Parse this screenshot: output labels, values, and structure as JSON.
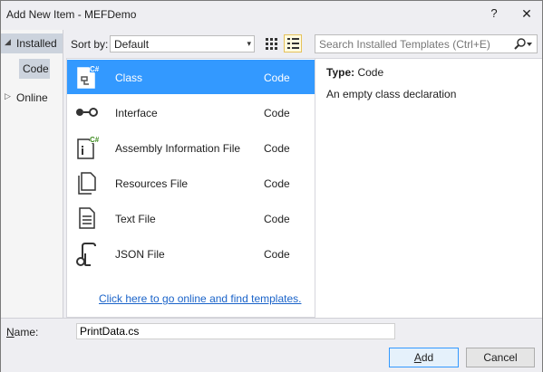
{
  "window": {
    "title": "Add New Item - MEFDemo",
    "help_glyph": "?",
    "close_glyph": "✕"
  },
  "tree": {
    "installed": {
      "arrow": "◢",
      "label": "Installed"
    },
    "code": "Code",
    "online": {
      "arrow": "▷",
      "label": "Online"
    }
  },
  "toolbar": {
    "sort_label": "Sort by:",
    "sort_value": "Default",
    "sort_caret": "▾",
    "search_placeholder": "Search Installed Templates (Ctrl+E)"
  },
  "items": [
    {
      "name": "Class",
      "type": "Code",
      "icon": "csharp-class-icon",
      "selected": true
    },
    {
      "name": "Interface",
      "type": "Code",
      "icon": "interface-icon",
      "selected": false
    },
    {
      "name": "Assembly Information File",
      "type": "Code",
      "icon": "csharp-assembly-info-icon",
      "selected": false
    },
    {
      "name": "Resources File",
      "type": "Code",
      "icon": "resources-file-icon",
      "selected": false
    },
    {
      "name": "Text File",
      "type": "Code",
      "icon": "text-file-icon",
      "selected": false
    },
    {
      "name": "JSON File",
      "type": "Code",
      "icon": "json-file-icon",
      "selected": false
    }
  ],
  "online_link": "Click here to go online and find templates.",
  "details": {
    "type_label": "Type:",
    "type_value": "Code",
    "description": "An empty class declaration"
  },
  "bottom": {
    "name_label_access": "N",
    "name_label_rest": "ame:",
    "name_value": "PrintData.cs",
    "add_access": "A",
    "add_rest": "dd",
    "cancel_label": "Cancel"
  },
  "colors": {
    "selection": "#3399ff",
    "link": "#1a63c9",
    "dialog_bg": "#eeeef2"
  }
}
